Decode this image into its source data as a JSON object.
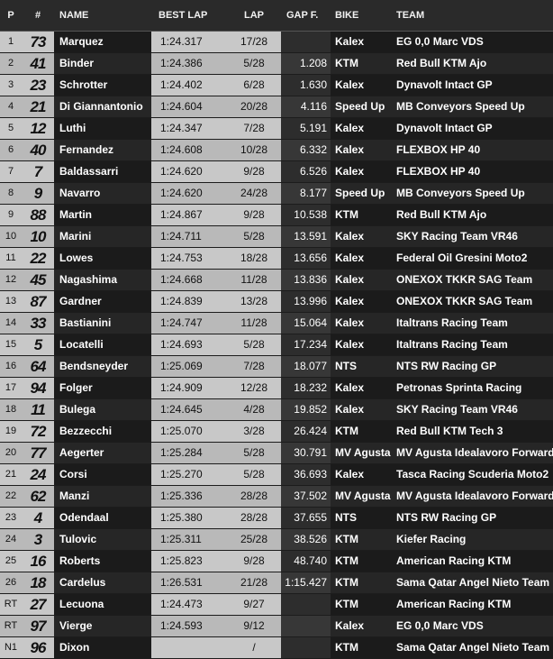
{
  "headers": {
    "p": "P",
    "num": "#",
    "name": "NAME",
    "best": "BEST LAP",
    "lap": "LAP",
    "gap": "GAP F.",
    "bike": "BIKE",
    "team": "TEAM"
  },
  "rows": [
    {
      "p": "1",
      "num": "73",
      "name": "Marquez",
      "best": "1:24.317",
      "lap": "17/28",
      "gap": "",
      "bike": "Kalex",
      "team": "EG 0,0 Marc VDS"
    },
    {
      "p": "2",
      "num": "41",
      "name": "Binder",
      "best": "1:24.386",
      "lap": "5/28",
      "gap": "1.208",
      "bike": "KTM",
      "team": "Red Bull KTM Ajo"
    },
    {
      "p": "3",
      "num": "23",
      "name": "Schrotter",
      "best": "1:24.402",
      "lap": "6/28",
      "gap": "1.630",
      "bike": "Kalex",
      "team": "Dynavolt Intact GP"
    },
    {
      "p": "4",
      "num": "21",
      "name": "Di Giannantonio",
      "best": "1:24.604",
      "lap": "20/28",
      "gap": "4.116",
      "bike": "Speed Up",
      "team": "MB Conveyors Speed Up"
    },
    {
      "p": "5",
      "num": "12",
      "name": "Luthi",
      "best": "1:24.347",
      "lap": "7/28",
      "gap": "5.191",
      "bike": "Kalex",
      "team": "Dynavolt Intact GP"
    },
    {
      "p": "6",
      "num": "40",
      "name": "Fernandez",
      "best": "1:24.608",
      "lap": "10/28",
      "gap": "6.332",
      "bike": "Kalex",
      "team": "FLEXBOX HP 40"
    },
    {
      "p": "7",
      "num": "7",
      "name": "Baldassarri",
      "best": "1:24.620",
      "lap": "9/28",
      "gap": "6.526",
      "bike": "Kalex",
      "team": "FLEXBOX HP 40"
    },
    {
      "p": "8",
      "num": "9",
      "name": "Navarro",
      "best": "1:24.620",
      "lap": "24/28",
      "gap": "8.177",
      "bike": "Speed Up",
      "team": "MB Conveyors Speed Up"
    },
    {
      "p": "9",
      "num": "88",
      "name": "Martin",
      "best": "1:24.867",
      "lap": "9/28",
      "gap": "10.538",
      "bike": "KTM",
      "team": "Red Bull KTM Ajo"
    },
    {
      "p": "10",
      "num": "10",
      "name": "Marini",
      "best": "1:24.711",
      "lap": "5/28",
      "gap": "13.591",
      "bike": "Kalex",
      "team": "SKY Racing Team VR46"
    },
    {
      "p": "11",
      "num": "22",
      "name": "Lowes",
      "best": "1:24.753",
      "lap": "18/28",
      "gap": "13.656",
      "bike": "Kalex",
      "team": "Federal Oil Gresini Moto2"
    },
    {
      "p": "12",
      "num": "45",
      "name": "Nagashima",
      "best": "1:24.668",
      "lap": "11/28",
      "gap": "13.836",
      "bike": "Kalex",
      "team": "ONEXOX TKKR SAG Team"
    },
    {
      "p": "13",
      "num": "87",
      "name": "Gardner",
      "best": "1:24.839",
      "lap": "13/28",
      "gap": "13.996",
      "bike": "Kalex",
      "team": "ONEXOX TKKR SAG Team"
    },
    {
      "p": "14",
      "num": "33",
      "name": "Bastianini",
      "best": "1:24.747",
      "lap": "11/28",
      "gap": "15.064",
      "bike": "Kalex",
      "team": "Italtrans Racing Team"
    },
    {
      "p": "15",
      "num": "5",
      "name": "Locatelli",
      "best": "1:24.693",
      "lap": "5/28",
      "gap": "17.234",
      "bike": "Kalex",
      "team": "Italtrans Racing Team"
    },
    {
      "p": "16",
      "num": "64",
      "name": "Bendsneyder",
      "best": "1:25.069",
      "lap": "7/28",
      "gap": "18.077",
      "bike": "NTS",
      "team": "NTS RW Racing GP"
    },
    {
      "p": "17",
      "num": "94",
      "name": "Folger",
      "best": "1:24.909",
      "lap": "12/28",
      "gap": "18.232",
      "bike": "Kalex",
      "team": "Petronas Sprinta Racing"
    },
    {
      "p": "18",
      "num": "11",
      "name": "Bulega",
      "best": "1:24.645",
      "lap": "4/28",
      "gap": "19.852",
      "bike": "Kalex",
      "team": "SKY Racing Team VR46"
    },
    {
      "p": "19",
      "num": "72",
      "name": "Bezzecchi",
      "best": "1:25.070",
      "lap": "3/28",
      "gap": "26.424",
      "bike": "KTM",
      "team": "Red Bull KTM Tech 3"
    },
    {
      "p": "20",
      "num": "77",
      "name": "Aegerter",
      "best": "1:25.284",
      "lap": "5/28",
      "gap": "30.791",
      "bike": "MV Agusta",
      "team": "MV Agusta Idealavoro Forward"
    },
    {
      "p": "21",
      "num": "24",
      "name": "Corsi",
      "best": "1:25.270",
      "lap": "5/28",
      "gap": "36.693",
      "bike": "Kalex",
      "team": "Tasca Racing Scuderia Moto2"
    },
    {
      "p": "22",
      "num": "62",
      "name": "Manzi",
      "best": "1:25.336",
      "lap": "28/28",
      "gap": "37.502",
      "bike": "MV Agusta",
      "team": "MV Agusta Idealavoro Forward"
    },
    {
      "p": "23",
      "num": "4",
      "name": "Odendaal",
      "best": "1:25.380",
      "lap": "28/28",
      "gap": "37.655",
      "bike": "NTS",
      "team": "NTS RW Racing GP"
    },
    {
      "p": "24",
      "num": "3",
      "name": "Tulovic",
      "best": "1:25.311",
      "lap": "25/28",
      "gap": "38.526",
      "bike": "KTM",
      "team": "Kiefer Racing"
    },
    {
      "p": "25",
      "num": "16",
      "name": "Roberts",
      "best": "1:25.823",
      "lap": "9/28",
      "gap": "48.740",
      "bike": "KTM",
      "team": "American Racing KTM"
    },
    {
      "p": "26",
      "num": "18",
      "name": "Cardelus",
      "best": "1:26.531",
      "lap": "21/28",
      "gap": "1:15.427",
      "bike": "KTM",
      "team": "Sama Qatar Angel Nieto Team"
    },
    {
      "p": "RT",
      "num": "27",
      "name": "Lecuona",
      "best": "1:24.473",
      "lap": "9/27",
      "gap": "",
      "bike": "KTM",
      "team": "American Racing KTM"
    },
    {
      "p": "RT",
      "num": "97",
      "name": "Vierge",
      "best": "1:24.593",
      "lap": "9/12",
      "gap": "",
      "bike": "Kalex",
      "team": "EG 0,0 Marc VDS"
    },
    {
      "p": "N1",
      "num": "96",
      "name": "Dixon",
      "best": "",
      "lap": "/",
      "gap": "",
      "bike": "KTM",
      "team": "Sama Qatar Angel Nieto Team"
    }
  ]
}
